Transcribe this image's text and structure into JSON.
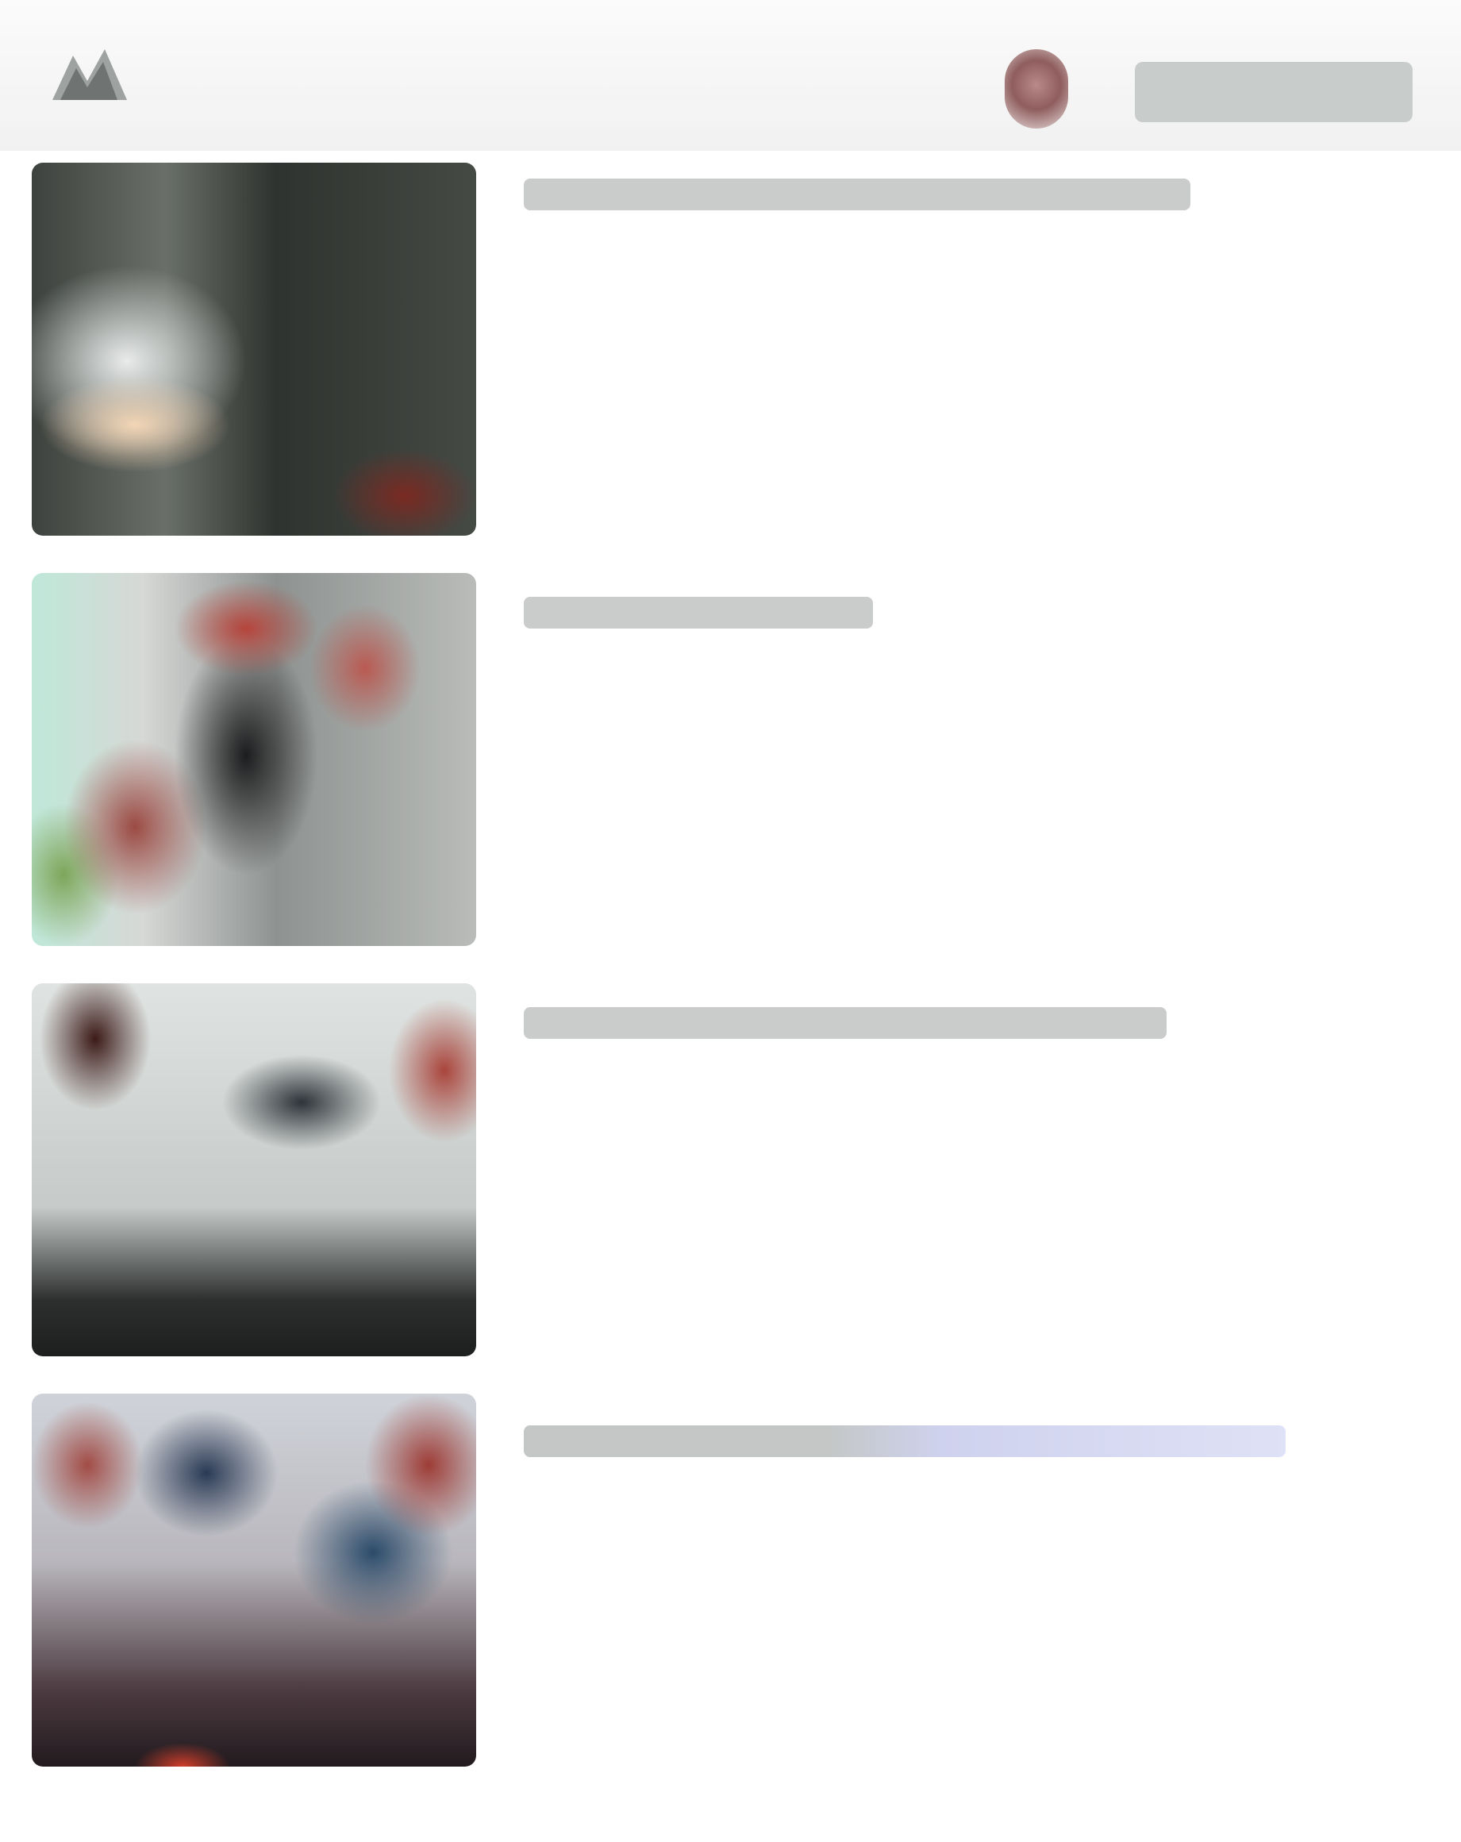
{
  "header": {
    "logo_icon": "site-logo-icon",
    "avatar_icon": "profile-avatar",
    "action_label": "",
    "colors": {
      "header_bg": "#f4f4f4",
      "action_bg": "#c8ccca",
      "headline_text": "#3a3d3c",
      "link_tint": "#dfe1f6"
    }
  },
  "feed": {
    "items": [
      {
        "headline": "",
        "thumbnail": "news-thumbnail-1"
      },
      {
        "headline": "",
        "thumbnail": "news-thumbnail-2"
      },
      {
        "headline": "",
        "thumbnail": "news-thumbnail-3"
      },
      {
        "headline": "",
        "thumbnail": "news-thumbnail-4"
      }
    ]
  }
}
